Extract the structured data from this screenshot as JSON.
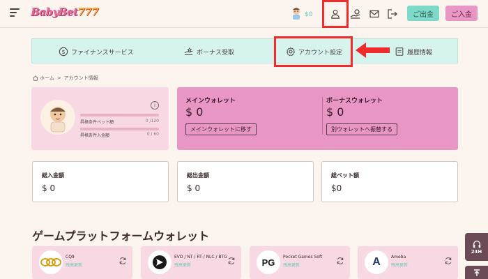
{
  "header": {
    "logo_text": "BabyBet",
    "logo_num": "777",
    "balance": "$0",
    "withdraw_label": "ご出金",
    "deposit_label": "ご入金",
    "icons": [
      "menu-icon",
      "user-icon",
      "coin-icon",
      "mail-icon",
      "logout-icon"
    ],
    "colors": {
      "withdraw_bg": "#7fd9c8",
      "deposit_bg": "#e896c3",
      "highlight": "#ee2c2c"
    }
  },
  "nav": {
    "items": [
      {
        "label": "ファイナンスサービス",
        "icon": "dollar-icon"
      },
      {
        "label": "ボーナス受取",
        "icon": "gift-icon"
      },
      {
        "label": "アカウント設定",
        "icon": "gear-icon"
      },
      {
        "label": "履歴情報",
        "icon": "history-icon"
      }
    ]
  },
  "breadcrumb": {
    "home": "ホーム",
    "separator": ">",
    "current": "アカウント情報"
  },
  "profile": {
    "bet_label": "昇格条件ベット額",
    "bet_value": "0 /120",
    "bet_progress": 0,
    "deposit_label": "昇格条件入金額",
    "deposit_value": "0 / 60",
    "deposit_progress": 0
  },
  "wallet": {
    "main_title": "メインウォレット",
    "main_amount": "$ 0",
    "main_button": "メインウォレットに移す",
    "bonus_title": "ボーナスウォレット",
    "bonus_amount": "$ 0",
    "bonus_button": "別ウォレットへ振替する",
    "color": "#e896c3"
  },
  "stats": [
    {
      "label": "総入金額",
      "value": "$ 0"
    },
    {
      "label": "総出金額",
      "value": "$ 0"
    },
    {
      "label": "総ベット額",
      "value": "$0"
    }
  ],
  "platforms": {
    "title": "ゲームプラットフォームウォレット",
    "items": [
      {
        "name": "CQ9",
        "status": "残高更新",
        "logo": "CQ9"
      },
      {
        "name": "EVO / NT / RT / NLC / BTG",
        "status": "残高更新",
        "logo": ""
      },
      {
        "name": "Pocket Games Soft",
        "status": "残高更新",
        "logo": "PG"
      },
      {
        "name": "Ameba",
        "status": "残高更新",
        "logo": "A"
      }
    ]
  },
  "support": {
    "label": "24H"
  }
}
